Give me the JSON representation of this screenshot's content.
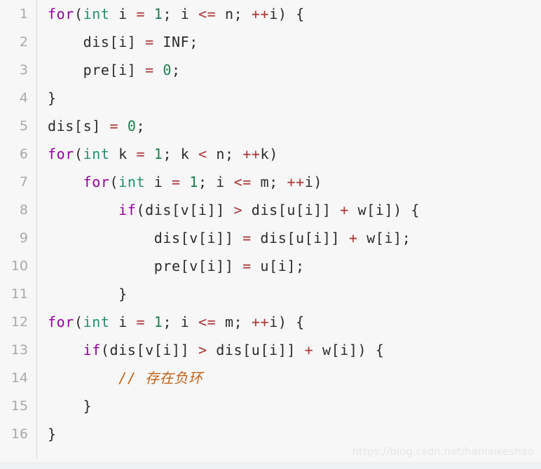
{
  "editor": {
    "language": "cpp",
    "background_color": "#f7f7f7",
    "gutter_rule_color": "#d4d4d4",
    "line_number_color": "#a9a9a9",
    "default_text_color": "#2b2b2b",
    "colors": {
      "keyword": "#9400A0",
      "type": "#23906A",
      "number": "#1A7F4F",
      "operator": "#AA3333",
      "comment": "#C06014",
      "plain": "#2b2b2b"
    },
    "lines": [
      {
        "number": "1",
        "tokens": [
          {
            "t": "for",
            "c": "kw"
          },
          {
            "t": "(",
            "c": "pl"
          },
          {
            "t": "int",
            "c": "type"
          },
          {
            "t": " i ",
            "c": "pl"
          },
          {
            "t": "=",
            "c": "op"
          },
          {
            "t": " ",
            "c": "pl"
          },
          {
            "t": "1",
            "c": "num"
          },
          {
            "t": "; i ",
            "c": "pl"
          },
          {
            "t": "<=",
            "c": "op"
          },
          {
            "t": " n; ",
            "c": "pl"
          },
          {
            "t": "++",
            "c": "op"
          },
          {
            "t": "i) {",
            "c": "pl"
          }
        ]
      },
      {
        "number": "2",
        "tokens": [
          {
            "t": "    dis[i] ",
            "c": "pl"
          },
          {
            "t": "=",
            "c": "op"
          },
          {
            "t": " INF;",
            "c": "pl"
          }
        ]
      },
      {
        "number": "3",
        "tokens": [
          {
            "t": "    pre[i] ",
            "c": "pl"
          },
          {
            "t": "=",
            "c": "op"
          },
          {
            "t": " ",
            "c": "pl"
          },
          {
            "t": "0",
            "c": "num"
          },
          {
            "t": ";",
            "c": "pl"
          }
        ]
      },
      {
        "number": "4",
        "tokens": [
          {
            "t": "}",
            "c": "pl"
          }
        ]
      },
      {
        "number": "5",
        "tokens": [
          {
            "t": "dis[s] ",
            "c": "pl"
          },
          {
            "t": "=",
            "c": "op"
          },
          {
            "t": " ",
            "c": "pl"
          },
          {
            "t": "0",
            "c": "num"
          },
          {
            "t": ";",
            "c": "pl"
          }
        ]
      },
      {
        "number": "6",
        "tokens": [
          {
            "t": "for",
            "c": "kw"
          },
          {
            "t": "(",
            "c": "pl"
          },
          {
            "t": "int",
            "c": "type"
          },
          {
            "t": " k ",
            "c": "pl"
          },
          {
            "t": "=",
            "c": "op"
          },
          {
            "t": " ",
            "c": "pl"
          },
          {
            "t": "1",
            "c": "num"
          },
          {
            "t": "; k ",
            "c": "pl"
          },
          {
            "t": "<",
            "c": "op"
          },
          {
            "t": " n; ",
            "c": "pl"
          },
          {
            "t": "++",
            "c": "op"
          },
          {
            "t": "k)",
            "c": "pl"
          }
        ]
      },
      {
        "number": "7",
        "tokens": [
          {
            "t": "    ",
            "c": "pl"
          },
          {
            "t": "for",
            "c": "kw"
          },
          {
            "t": "(",
            "c": "pl"
          },
          {
            "t": "int",
            "c": "type"
          },
          {
            "t": " i ",
            "c": "pl"
          },
          {
            "t": "=",
            "c": "op"
          },
          {
            "t": " ",
            "c": "pl"
          },
          {
            "t": "1",
            "c": "num"
          },
          {
            "t": "; i ",
            "c": "pl"
          },
          {
            "t": "<=",
            "c": "op"
          },
          {
            "t": " m; ",
            "c": "pl"
          },
          {
            "t": "++",
            "c": "op"
          },
          {
            "t": "i)",
            "c": "pl"
          }
        ]
      },
      {
        "number": "8",
        "tokens": [
          {
            "t": "        ",
            "c": "pl"
          },
          {
            "t": "if",
            "c": "kw"
          },
          {
            "t": "(dis[v[i]] ",
            "c": "pl"
          },
          {
            "t": ">",
            "c": "op"
          },
          {
            "t": " dis[u[i]] ",
            "c": "pl"
          },
          {
            "t": "+",
            "c": "op"
          },
          {
            "t": " w[i]) {",
            "c": "pl"
          }
        ]
      },
      {
        "number": "9",
        "tokens": [
          {
            "t": "            dis[v[i]] ",
            "c": "pl"
          },
          {
            "t": "=",
            "c": "op"
          },
          {
            "t": " dis[u[i]] ",
            "c": "pl"
          },
          {
            "t": "+",
            "c": "op"
          },
          {
            "t": " w[i];",
            "c": "pl"
          }
        ]
      },
      {
        "number": "10",
        "tokens": [
          {
            "t": "            pre[v[i]] ",
            "c": "pl"
          },
          {
            "t": "=",
            "c": "op"
          },
          {
            "t": " u[i];",
            "c": "pl"
          }
        ]
      },
      {
        "number": "11",
        "tokens": [
          {
            "t": "        }",
            "c": "pl"
          }
        ]
      },
      {
        "number": "12",
        "tokens": [
          {
            "t": "for",
            "c": "kw"
          },
          {
            "t": "(",
            "c": "pl"
          },
          {
            "t": "int",
            "c": "type"
          },
          {
            "t": " i ",
            "c": "pl"
          },
          {
            "t": "=",
            "c": "op"
          },
          {
            "t": " ",
            "c": "pl"
          },
          {
            "t": "1",
            "c": "num"
          },
          {
            "t": "; i ",
            "c": "pl"
          },
          {
            "t": "<=",
            "c": "op"
          },
          {
            "t": " m; ",
            "c": "pl"
          },
          {
            "t": "++",
            "c": "op"
          },
          {
            "t": "i) {",
            "c": "pl"
          }
        ]
      },
      {
        "number": "13",
        "tokens": [
          {
            "t": "    ",
            "c": "pl"
          },
          {
            "t": "if",
            "c": "kw"
          },
          {
            "t": "(dis[v[i]] ",
            "c": "pl"
          },
          {
            "t": ">",
            "c": "op"
          },
          {
            "t": " dis[u[i]] ",
            "c": "pl"
          },
          {
            "t": "+",
            "c": "op"
          },
          {
            "t": " w[i]) {",
            "c": "pl"
          }
        ]
      },
      {
        "number": "14",
        "tokens": [
          {
            "t": "        ",
            "c": "pl"
          },
          {
            "t": "// 存在负环",
            "c": "cmt"
          }
        ]
      },
      {
        "number": "15",
        "tokens": [
          {
            "t": "    }",
            "c": "pl"
          }
        ]
      },
      {
        "number": "16",
        "tokens": [
          {
            "t": "}",
            "c": "pl"
          }
        ]
      }
    ]
  },
  "watermark": {
    "text": "https://blog.csdn.net/hanlaikeshao"
  }
}
